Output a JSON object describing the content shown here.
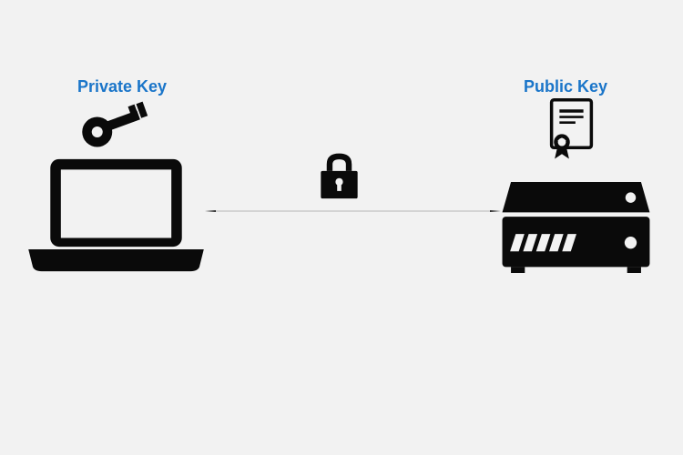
{
  "labels": {
    "private_key": "Private Key",
    "public_key": "Public Key"
  },
  "icons": {
    "key": "key-icon",
    "certificate": "certificate-icon",
    "laptop": "laptop-icon",
    "lock": "lock-icon",
    "server": "server-icon"
  },
  "colors": {
    "label": "#1a75c9",
    "icon": "#0a0a0a",
    "background": "#f2f2f2"
  }
}
